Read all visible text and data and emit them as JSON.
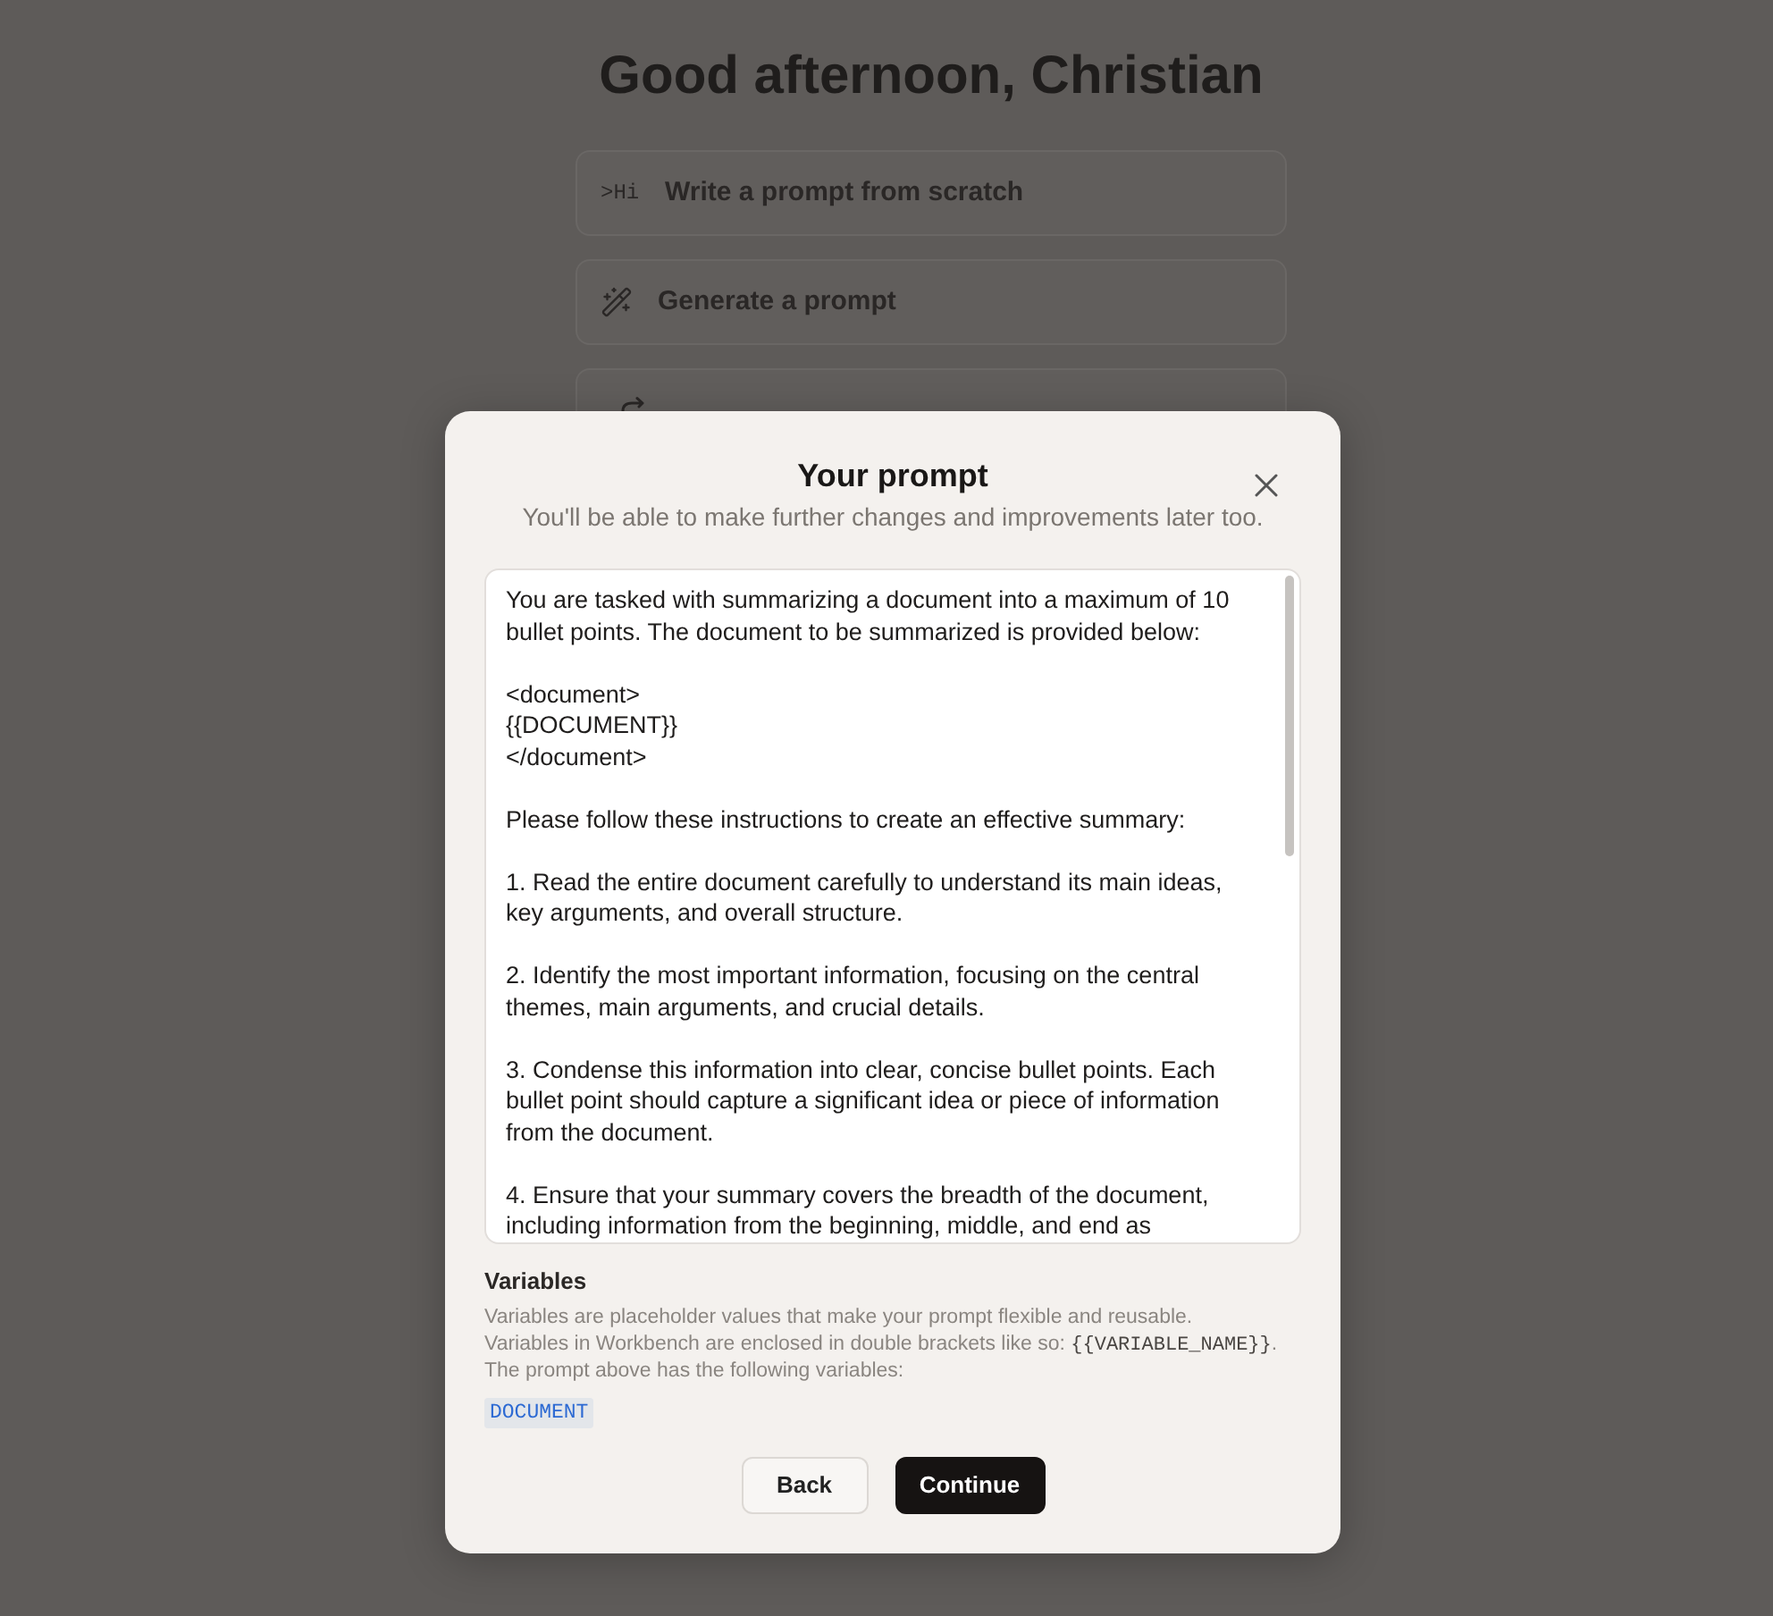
{
  "page": {
    "greeting": "Good afternoon, Christian",
    "options": [
      {
        "icon_text": ">Hi",
        "label": "Write a prompt from scratch"
      },
      {
        "label": "Generate a prompt"
      }
    ]
  },
  "dialog": {
    "title": "Your prompt",
    "subtitle": "You'll be able to make further changes and improvements later too.",
    "prompt": {
      "value": "You are tasked with summarizing a document into a maximum of 10 bullet points. The document to be summarized is provided below:\n\n<document>\n{{DOCUMENT}}\n</document>\n\nPlease follow these instructions to create an effective summary:\n\n1. Read the entire document carefully to understand its main ideas, key arguments, and overall structure.\n\n2. Identify the most important information, focusing on the central themes, main arguments, and crucial details.\n\n3. Condense this information into clear, concise bullet points. Each bullet point should capture a significant idea or piece of information from the document.\n\n4. Ensure that your summary covers the breadth of the document, including information from the beginning, middle, and end as"
    },
    "variables": {
      "heading": "Variables",
      "description": [
        [
          {
            "kind": "text",
            "text": "Variables are placeholder values that make your prompt flexible and reusable."
          }
        ],
        [
          {
            "kind": "text",
            "text": "Variables in Workbench are enclosed in double brackets like so: "
          },
          {
            "kind": "code",
            "text": "{{VARIABLE_NAME}}"
          },
          {
            "kind": "text",
            "text": "."
          }
        ],
        [
          {
            "kind": "text",
            "text": "The prompt above has the following variables:"
          }
        ]
      ],
      "items": [
        "DOCUMENT"
      ]
    },
    "buttons": [
      {
        "label": "Back",
        "kind": "secondary"
      },
      {
        "label": "Continue",
        "kind": "primary"
      }
    ]
  }
}
